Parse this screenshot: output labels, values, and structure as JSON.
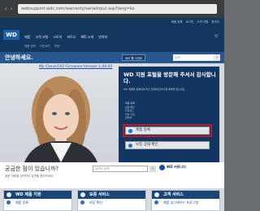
{
  "browser": {
    "url": "websupport.wdc.com/warranty/serialinput.asp?lang=ko"
  },
  "header": {
    "logo": "WD",
    "toplinks": [
      "제품 등록",
      "로그인",
      "고객 지원",
      "한국어"
    ],
    "mainnav": [
      "제품",
      "고객 지원",
      "스토어",
      "파트너",
      "WD 소개",
      "연락처"
    ],
    "subnav": [
      "제품 정보",
      "다운로드",
      "보증"
    ]
  },
  "greeting": {
    "title": "안녕하세요.",
    "lang_button": "WD 웹 사이트",
    "search_placeholder": "검색",
    "search_go": "›"
  },
  "hero": {
    "breadcrumb": "My Cloud EX2 Firmware Version 1.04.05",
    "panel_title": "WD 지원 포털을 방문해 주셔서 감사합니다.",
    "panel_desc": "WD 제품을 등록하여 최신 업데이트와 지원 혜택을 받으세요.",
    "panel_list": [
      "· 제품 등록",
      "· 보증 확인",
      "· 다운로드",
      "· 지식 기반",
      "· 연락처"
    ],
    "register_button": "제품 등록",
    "warranty_button": "보증 상태 확인"
  },
  "question": {
    "title": "궁금한 점이 있습니까?",
    "subtitle": "질문 내용을 입력하여 답변을 찾아보세요.",
    "search_placeholder": "검색어 입력",
    "search_go": "›",
    "community": "WD 커뮤니티"
  },
  "bottom": [
    {
      "title": "WD 제품 지원",
      "item": "제품 등록"
    },
    {
      "title": "보증 서비스",
      "item": "보증 확인"
    },
    {
      "title": "고객 서비스",
      "item": "제품 업그레이드 프로그램"
    }
  ]
}
